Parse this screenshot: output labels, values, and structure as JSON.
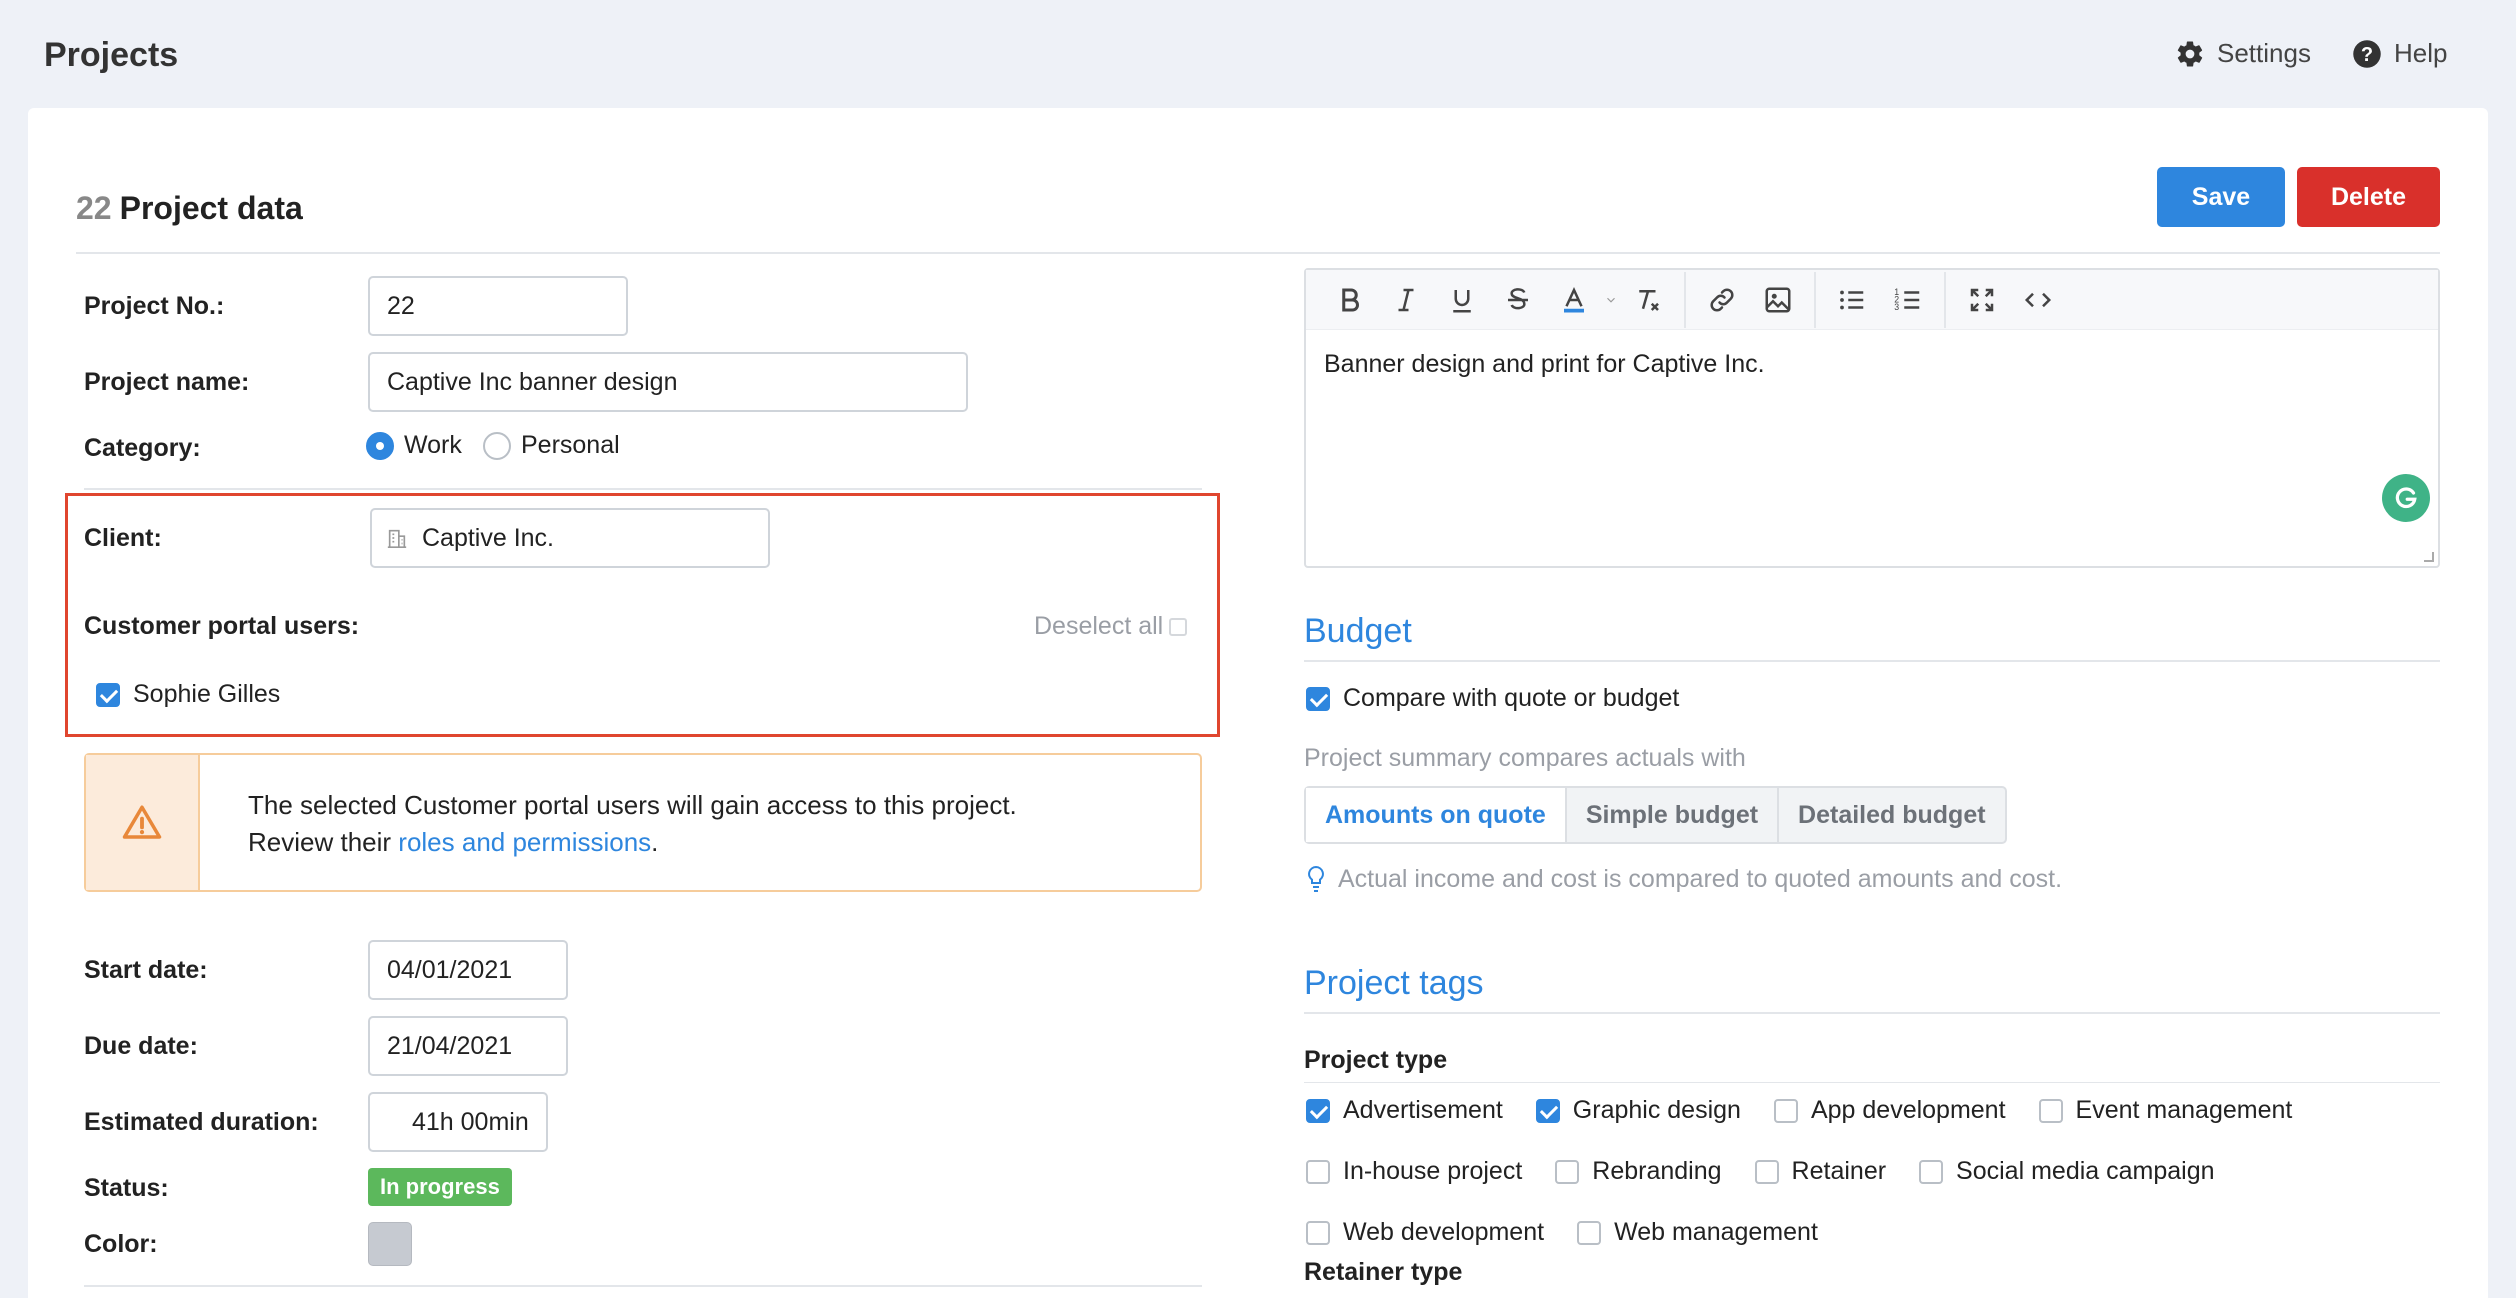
{
  "header": {
    "app_title": "Projects",
    "settings_label": "Settings",
    "help_label": "Help"
  },
  "page": {
    "project_number": "22",
    "title": "Project data",
    "save_label": "Save",
    "delete_label": "Delete"
  },
  "form": {
    "project_no_label": "Project No.:",
    "project_no_value": "22",
    "project_name_label": "Project name:",
    "project_name_value": "Captive Inc banner design",
    "category_label": "Category:",
    "category_options": [
      "Work",
      "Personal"
    ],
    "category_selected": "Work",
    "client_label": "Client:",
    "client_value": "Captive Inc.",
    "portal_users_label": "Customer portal users:",
    "deselect_all_label": "Deselect all",
    "portal_users": [
      {
        "name": "Sophie Gilles",
        "checked": true
      }
    ],
    "alert_line1": "The selected Customer portal users will gain access to this project.",
    "alert_line2_prefix": "Review their ",
    "alert_link": "roles and permissions",
    "alert_line2_suffix": ".",
    "start_date_label": "Start date:",
    "start_date_value": "04/01/2021",
    "due_date_label": "Due date:",
    "due_date_value": "21/04/2021",
    "duration_label": "Estimated duration:",
    "duration_value": "41h 00min",
    "status_label": "Status:",
    "status_value": "In progress",
    "status_color": "#5cb85c",
    "color_label": "Color:",
    "color_value": "#c6cad1"
  },
  "editor": {
    "toolbar_icons": [
      "bold-icon",
      "italic-icon",
      "underline-icon",
      "strikethrough-icon",
      "text-color-icon",
      "clear-format-icon",
      "link-icon",
      "image-icon",
      "bullet-list-icon",
      "numbered-list-icon",
      "fullscreen-icon",
      "code-view-icon"
    ],
    "content": "Banner design and print for Captive Inc."
  },
  "budget": {
    "title": "Budget",
    "compare_label": "Compare with quote or budget",
    "compare_checked": true,
    "summary_label": "Project summary compares actuals with",
    "options": [
      "Amounts on quote",
      "Simple budget",
      "Detailed budget"
    ],
    "selected": "Amounts on quote",
    "hint": "Actual income and cost is compared to quoted amounts and cost."
  },
  "tags": {
    "title": "Project tags",
    "project_type_label": "Project type",
    "items": [
      {
        "label": "Advertisement",
        "checked": true
      },
      {
        "label": "Graphic design",
        "checked": true
      },
      {
        "label": "App development",
        "checked": false
      },
      {
        "label": "Event management",
        "checked": false
      },
      {
        "label": "In-house project",
        "checked": false
      },
      {
        "label": "Rebranding",
        "checked": false
      },
      {
        "label": "Retainer",
        "checked": false
      },
      {
        "label": "Social media campaign",
        "checked": false
      },
      {
        "label": "Web development",
        "checked": false
      },
      {
        "label": "Web management",
        "checked": false
      }
    ],
    "retainer_type_label": "Retainer type"
  },
  "colors": {
    "accent": "#2e86de",
    "danger": "#d9302b",
    "highlight_border": "#e0462f",
    "warning_bg": "#fcebdb"
  }
}
